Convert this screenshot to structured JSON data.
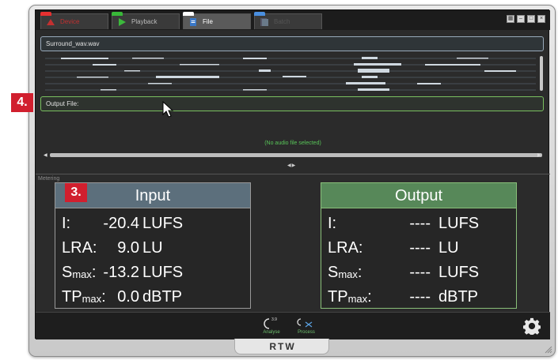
{
  "tabs": [
    {
      "label": "Device",
      "icon": "device-icon"
    },
    {
      "label": "Playback",
      "icon": "play-icon"
    },
    {
      "label": "File",
      "icon": "file-icon"
    },
    {
      "label": "Batch",
      "icon": "batch-icon"
    }
  ],
  "file": {
    "input_filename": "Surround_wav.wav",
    "output_label": "Output File:",
    "status": "(No audio file selected)"
  },
  "metering": {
    "section_label": "Metering",
    "input": {
      "title": "Input",
      "rows": [
        {
          "key": "I:",
          "value": "-20.4",
          "unit": "LUFS"
        },
        {
          "key": "LRA:",
          "value": "9.0",
          "unit": "LU"
        },
        {
          "key": "S",
          "key_sub": "max",
          "key_suffix": ":",
          "value": "-13.2",
          "unit": "LUFS"
        },
        {
          "key": "TP",
          "key_sub": "max",
          "key_suffix": ":",
          "value": "0.0",
          "unit": "dBTP"
        }
      ]
    },
    "output": {
      "title": "Output",
      "rows": [
        {
          "key": "I:",
          "value": "----",
          "unit": "LUFS"
        },
        {
          "key": "LRA:",
          "value": "----",
          "unit": "LU"
        },
        {
          "key": "S",
          "key_sub": "max",
          "key_suffix": ":",
          "value": "----",
          "unit": "LUFS"
        },
        {
          "key": "TP",
          "key_sub": "max",
          "key_suffix": ":",
          "value": "----",
          "unit": "dBTP"
        }
      ]
    }
  },
  "bottom": {
    "analyse_label": "Analyse",
    "analyse_version": "3.9",
    "process_label": "Process"
  },
  "brand": "RTW",
  "callouts": {
    "c3": "3.",
    "c4": "4."
  },
  "colors": {
    "accent_green": "#58c458",
    "callout_red": "#d11f2e",
    "input_head": "#5c6f7c",
    "output_head": "#578859"
  }
}
